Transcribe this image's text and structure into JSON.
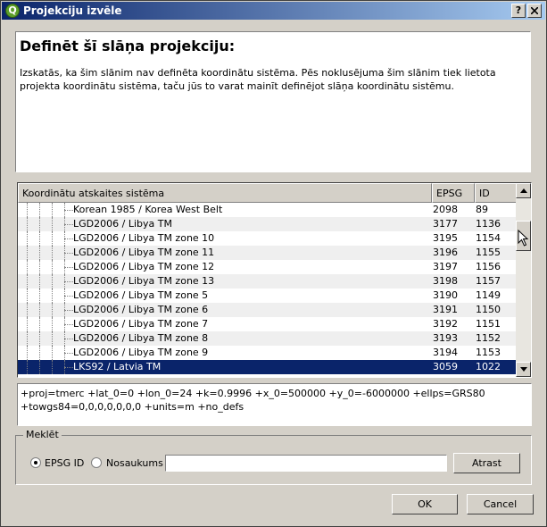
{
  "window": {
    "title": "Projekciju izvēle",
    "help_btn": "?",
    "close_btn": "X"
  },
  "info": {
    "heading": "Definēt šī slāņa projekciju:",
    "description": "Izskatās, ka šim slānim nav definēta koordinātu sistēma. Pēs noklusējuma šim slānim tiek lietota projekta koordinātu sistēma, taču jūs to varat mainīt definējot slāņa koordinātu sistēmu."
  },
  "crs_tree": {
    "columns": [
      "Koordinātu atskaites sistēma",
      "EPSG",
      "ID"
    ],
    "rows": [
      {
        "name": "Korean 1985 / Korea West Belt",
        "epsg": "2098",
        "id": "89"
      },
      {
        "name": "LGD2006 / Libya TM",
        "epsg": "3177",
        "id": "1136"
      },
      {
        "name": "LGD2006 / Libya TM zone 10",
        "epsg": "3195",
        "id": "1154"
      },
      {
        "name": "LGD2006 / Libya TM zone 11",
        "epsg": "3196",
        "id": "1155"
      },
      {
        "name": "LGD2006 / Libya TM zone 12",
        "epsg": "3197",
        "id": "1156"
      },
      {
        "name": "LGD2006 / Libya TM zone 13",
        "epsg": "3198",
        "id": "1157"
      },
      {
        "name": "LGD2006 / Libya TM zone 5",
        "epsg": "3190",
        "id": "1149"
      },
      {
        "name": "LGD2006 / Libya TM zone 6",
        "epsg": "3191",
        "id": "1150"
      },
      {
        "name": "LGD2006 / Libya TM zone 7",
        "epsg": "3192",
        "id": "1151"
      },
      {
        "name": "LGD2006 / Libya TM zone 8",
        "epsg": "3193",
        "id": "1152"
      },
      {
        "name": "LGD2006 / Libya TM zone 9",
        "epsg": "3194",
        "id": "1153"
      },
      {
        "name": "LKS92 / Latvia TM",
        "epsg": "3059",
        "id": "1022",
        "selected": true
      }
    ]
  },
  "proj_string": "+proj=tmerc +lat_0=0 +lon_0=24 +k=0.9996 +x_0=500000 +y_0=-6000000 +ellps=GRS80 +towgs84=0,0,0,0,0,0,0 +units=m +no_defs",
  "search": {
    "legend": "Meklēt",
    "option_epsg": "EPSG ID",
    "option_name": "Nosaukums",
    "selected_option": "EPSG ID",
    "value": "",
    "find_btn": "Atrast"
  },
  "dialog_buttons": {
    "ok": "OK",
    "cancel": "Cancel"
  }
}
